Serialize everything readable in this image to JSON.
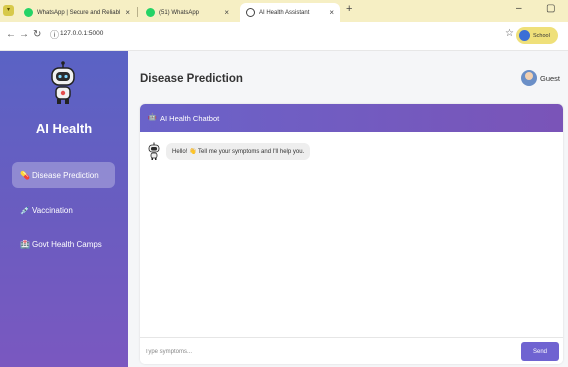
{
  "browser": {
    "tabs": [
      {
        "label": "WhatsApp | Secure and Reliabl",
        "close": "×",
        "favicon_color": "#25d366"
      },
      {
        "label": "(51) WhatsApp",
        "close": "×",
        "favicon_color": "#25d366"
      },
      {
        "label": "AI Health Assistant",
        "close": "×",
        "favicon_color": "#444444"
      }
    ],
    "new_tab": "+",
    "url": "127.0.0.1:5000",
    "profile": "School",
    "window_controls": {
      "minimize": "–",
      "maximize": "▢"
    }
  },
  "sidebar": {
    "brand": "AI Health",
    "items": [
      {
        "label": "Disease Prediction",
        "icon": "💊",
        "active": true
      },
      {
        "label": "Vaccination",
        "icon": "💉",
        "active": false
      },
      {
        "label": "Govt Health Camps",
        "icon": "🏥",
        "active": false
      }
    ]
  },
  "header": {
    "title": "Disease Prediction",
    "user": "Guest"
  },
  "chat": {
    "title": "AI Health Chatbot",
    "messages": [
      {
        "from": "bot",
        "text": "Hello! 👋 Tell me your symptoms and I'll help you."
      }
    ],
    "input_placeholder": "Type symptoms...",
    "send_label": "Send"
  },
  "colors": {
    "sidebar_top": "#5a63c4",
    "sidebar_bottom": "#7a58c0",
    "accent": "#6f63d1",
    "tabbar": "#f6efc4"
  }
}
